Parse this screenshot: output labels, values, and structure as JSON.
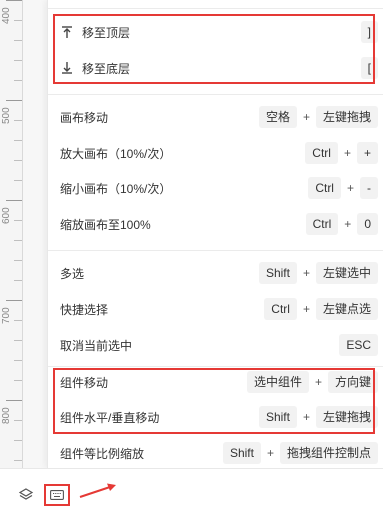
{
  "ruler": {
    "marks": [
      "400",
      "500",
      "600",
      "700",
      "800"
    ]
  },
  "shortcuts": {
    "bring_to_top": {
      "label": "移至顶层",
      "icon": "bring-to-top-icon",
      "keys": [
        "]"
      ]
    },
    "send_to_bottom": {
      "label": "移至底层",
      "icon": "send-to-bottom-icon",
      "keys": [
        "["
      ]
    },
    "pan_canvas": {
      "label": "画布移动",
      "keys": [
        "空格",
        "左键拖拽"
      ]
    },
    "zoom_in": {
      "label": "放大画布（10%/次）",
      "keys": [
        "Ctrl",
        "+"
      ]
    },
    "zoom_out": {
      "label": "缩小画布（10%/次）",
      "keys": [
        "Ctrl",
        "-"
      ]
    },
    "zoom_reset": {
      "label": "缩放画布至100%",
      "keys": [
        "Ctrl",
        "0"
      ]
    },
    "multi_select": {
      "label": "多选",
      "keys": [
        "Shift",
        "左键选中"
      ]
    },
    "quick_select": {
      "label": "快捷选择",
      "keys": [
        "Ctrl",
        "左键点选"
      ]
    },
    "deselect": {
      "label": "取消当前选中",
      "keys": [
        "ESC"
      ]
    },
    "move_component": {
      "label": "组件移动",
      "keys": [
        "选中组件",
        "方向键"
      ]
    },
    "move_hv": {
      "label": "组件水平/垂直移动",
      "keys": [
        "Shift",
        "左键拖拽"
      ]
    },
    "scale_prop": {
      "label": "组件等比例缩放",
      "keys": [
        "Shift",
        "拖拽组件控制点"
      ]
    },
    "plus_symbol": "+"
  },
  "toolbar": {
    "layers_icon": "layers-icon",
    "keyboard_icon": "keyboard-icon",
    "arrow_icon": "red-arrow-icon"
  },
  "colors": {
    "highlight": "#e53935",
    "key_bg": "#f2f2f2"
  }
}
